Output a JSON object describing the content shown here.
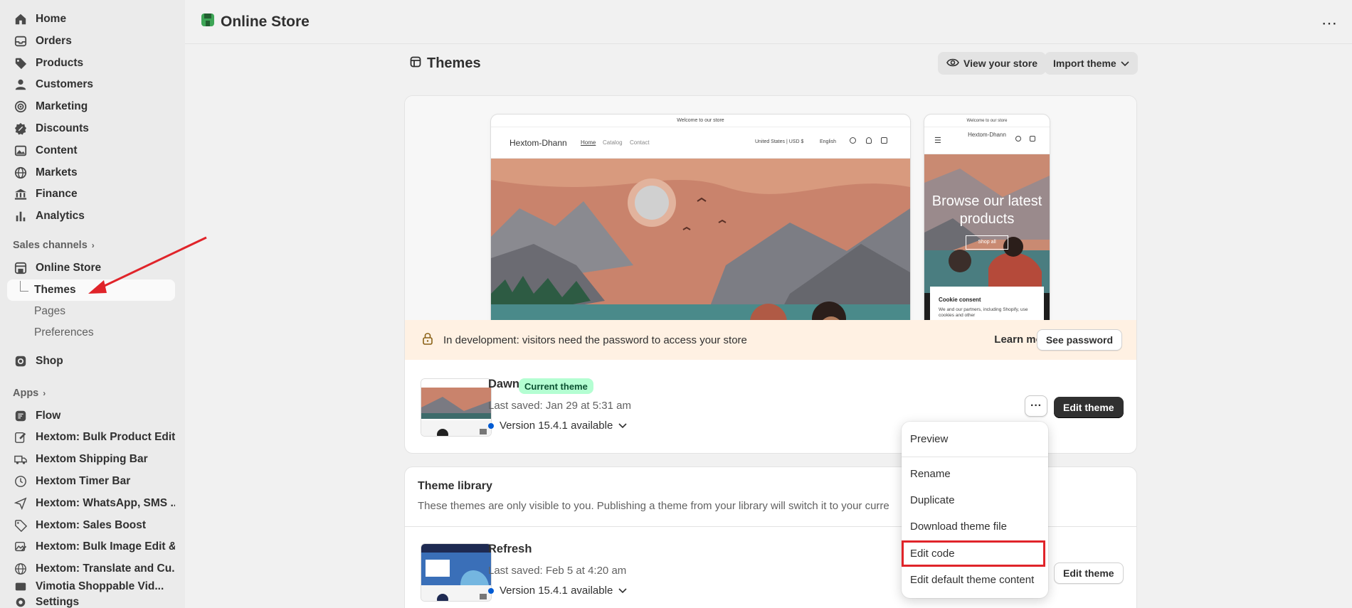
{
  "sidebar": {
    "main_items": [
      {
        "label": "Home",
        "icon": "home-icon"
      },
      {
        "label": "Orders",
        "icon": "inbox-icon"
      },
      {
        "label": "Products",
        "icon": "tag-icon"
      },
      {
        "label": "Customers",
        "icon": "person-icon"
      },
      {
        "label": "Marketing",
        "icon": "target-icon"
      },
      {
        "label": "Discounts",
        "icon": "discount-icon"
      },
      {
        "label": "Content",
        "icon": "image-icon"
      },
      {
        "label": "Markets",
        "icon": "globe-icon"
      },
      {
        "label": "Finance",
        "icon": "bank-icon"
      },
      {
        "label": "Analytics",
        "icon": "bar-chart-icon"
      }
    ],
    "sales_channels_label": "Sales channels",
    "online_store_label": "Online Store",
    "sub_items": [
      "Themes",
      "Pages",
      "Preferences"
    ],
    "shop_label": "Shop",
    "apps_label": "Apps",
    "apps": [
      {
        "label": "Flow",
        "icon": "flow-icon"
      },
      {
        "label": "Hextom: Bulk Product Edit",
        "icon": "edit-icon"
      },
      {
        "label": "Hextom Shipping Bar",
        "icon": "truck-icon"
      },
      {
        "label": "Hextom Timer Bar",
        "icon": "clock-icon"
      },
      {
        "label": "Hextom: WhatsApp, SMS ...",
        "icon": "send-icon"
      },
      {
        "label": "Hextom: Sales Boost",
        "icon": "tag-icon"
      },
      {
        "label": "Hextom: Bulk Image Edit &...",
        "icon": "image-edit-icon"
      },
      {
        "label": "Hextom: Translate and Cu...",
        "icon": "globe-icon"
      },
      {
        "label": "Vimotia Shoppable Vid...",
        "icon": "video-icon"
      }
    ],
    "settings_label": "Settings"
  },
  "topbar": {
    "title": "Online Store"
  },
  "header": {
    "title": "Themes",
    "view_store": "View your store",
    "import_theme": "Import theme"
  },
  "current_theme": {
    "desktop_preview": {
      "announcement": "Welcome to our store",
      "store_name": "Hextom-Dhann",
      "nav": [
        "Home",
        "Catalog",
        "Contact"
      ],
      "locale": "United States | USD $",
      "language": "English"
    },
    "mobile_preview": {
      "announcement": "Welcome to our store",
      "store_name": "Hextom-Dhann",
      "hero_text": "Browse our latest products",
      "hero_button": "Shop all",
      "cookie_title": "Cookie consent",
      "cookie_text": "We and our partners, including Shopify, use cookies and other"
    },
    "banner_text": "In development: visitors need the password to access your store",
    "learn_more": "Learn more",
    "see_password": "See password",
    "name": "Dawn",
    "badge": "Current theme",
    "last_saved": "Last saved: Jan 29 at 5:31 am",
    "version": "Version 15.4.1 available",
    "edit_theme": "Edit theme"
  },
  "library": {
    "title": "Theme library",
    "description": "These themes are only visible to you. Publishing a theme from your library will switch it to your curre",
    "themes": [
      {
        "name": "Refresh",
        "last_saved": "Last saved: Feb 5 at 4:20 am",
        "version": "Version 15.4.1 available",
        "edit": "Edit theme"
      }
    ]
  },
  "menu": {
    "items": [
      "Preview",
      "Rename",
      "Duplicate",
      "Download theme file",
      "Edit code",
      "Edit default theme content"
    ]
  },
  "colors": {
    "annotation_red": "#e0242a",
    "badge_green": "#b4fed2",
    "banner_orange": "#fff1e3",
    "dark_button": "#303030"
  }
}
